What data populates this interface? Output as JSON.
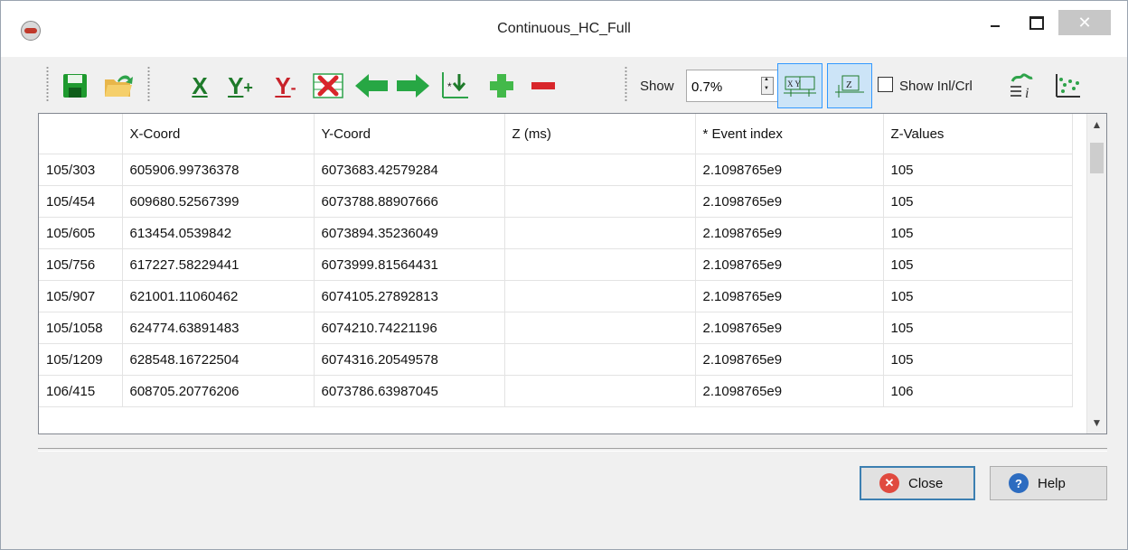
{
  "window": {
    "title": "Continuous_HC_Full"
  },
  "controls": {
    "close_glyph": "✕"
  },
  "toolbar": {
    "x_label": "X",
    "yplus_label": "Y",
    "yplus_sub": "+",
    "yminus_label": "Y",
    "yminus_sub": "-",
    "show_label": "Show",
    "show_value": "0.7%",
    "xy_toggle_text": "X Y",
    "z_toggle_text": "Z",
    "show_inl_crl_label": "Show Inl/Crl",
    "icons": [
      "save-icon",
      "open-icon",
      "set-x-icon",
      "add-y-icon",
      "remove-y-icon",
      "delete-column-icon",
      "move-left-icon",
      "move-right-icon",
      "set-z-icon",
      "add-row-icon",
      "remove-row-icon",
      "xy-display-icon",
      "z-display-icon",
      "inline-crossline-icon",
      "scatter-plot-icon"
    ]
  },
  "table": {
    "columns": [
      "",
      "X-Coord",
      "Y-Coord",
      "Z (ms)",
      "* Event index",
      "Z-Values"
    ],
    "rows": [
      [
        "105/303",
        "605906.99736378",
        "6073683.42579284",
        "",
        "2.1098765e9",
        "105"
      ],
      [
        "105/454",
        "609680.52567399",
        "6073788.88907666",
        "",
        "2.1098765e9",
        "105"
      ],
      [
        "105/605",
        "613454.0539842",
        "6073894.35236049",
        "",
        "2.1098765e9",
        "105"
      ],
      [
        "105/756",
        "617227.58229441",
        "6073999.81564431",
        "",
        "2.1098765e9",
        "105"
      ],
      [
        "105/907",
        "621001.11060462",
        "6074105.27892813",
        "",
        "2.1098765e9",
        "105"
      ],
      [
        "105/1058",
        "624774.63891483",
        "6074210.74221196",
        "",
        "2.1098765e9",
        "105"
      ],
      [
        "105/1209",
        "628548.16722504",
        "6074316.20549578",
        "",
        "2.1098765e9",
        "105"
      ],
      [
        "106/415",
        "608705.20776206",
        "6073786.63987045",
        "",
        "2.1098765e9",
        "106"
      ]
    ]
  },
  "buttons": {
    "close_label": "Close",
    "help_label": "Help"
  },
  "colors": {
    "accent": "#3399ff",
    "green": "#1e9a2e",
    "red": "#d8262b",
    "close_icon": "#e04a3f",
    "help_icon": "#2d6cc0"
  }
}
